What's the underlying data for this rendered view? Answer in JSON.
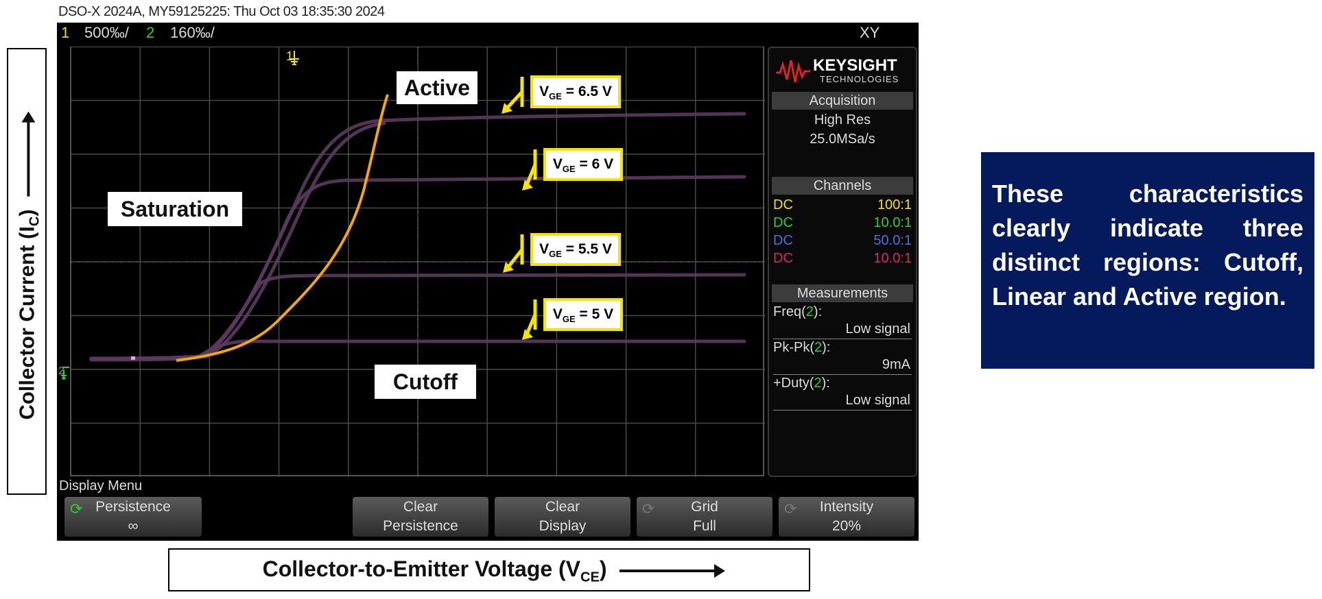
{
  "header": {
    "instrument_line": "DSO-X 2024A, MY59125225: Thu Oct 03 18:35:30 2024"
  },
  "topbar": {
    "ch1_num": "1",
    "ch1_scale": "500‰/",
    "ch2_num": "2",
    "ch2_scale": "160‰/",
    "mode": "XY",
    "colors": {
      "ch1": "#f5e400",
      "ch2": "#2fd12f"
    }
  },
  "plot": {
    "ch1_marker": "1",
    "ch2_marker": "2",
    "trace_color": "#5b3a5e",
    "boundary_color": "#f5a800"
  },
  "regions": {
    "active": "Active",
    "saturation": "Saturation",
    "cutoff": "Cutoff"
  },
  "vge_labels": [
    {
      "prefix": "V",
      "sub": "GE",
      "suffix": " = 6.5 V"
    },
    {
      "prefix": "V",
      "sub": "GE",
      "suffix": " = 6 V"
    },
    {
      "prefix": "V",
      "sub": "GE",
      "suffix": " = 5.5 V"
    },
    {
      "prefix": "V",
      "sub": "GE",
      "suffix": " = 5 V"
    }
  ],
  "panel": {
    "brand": "KEYSIGHT",
    "brand_sub": "TECHNOLOGIES",
    "acquisition": {
      "title": "Acquisition",
      "mode": "High Res",
      "rate": "25.0MSa/s"
    },
    "channels": {
      "title": "Channels",
      "rows": [
        {
          "coupling": "DC",
          "ratio": "100:1",
          "color": "#f5e400"
        },
        {
          "coupling": "DC",
          "ratio": "10.0:1",
          "color": "#2fd12f"
        },
        {
          "coupling": "DC",
          "ratio": "50.0:1",
          "color": "#4f6fe0"
        },
        {
          "coupling": "DC",
          "ratio": "10.0:1",
          "color": "#e0246a"
        }
      ]
    },
    "measurements": {
      "title": "Measurements",
      "items": [
        {
          "name": "Freq(",
          "ch": "2",
          "close": "):",
          "value": "Low signal"
        },
        {
          "name": "Pk-Pk(",
          "ch": "2",
          "close": "):",
          "value": "9mA"
        },
        {
          "name": "+Duty(",
          "ch": "2",
          "close": "):",
          "value": "Low signal"
        }
      ]
    }
  },
  "menu": {
    "title": "Display Menu",
    "softkeys": [
      {
        "line1": "Persistence",
        "line2": "∞"
      },
      {
        "line1": "Clear",
        "line2": "Persistence"
      },
      {
        "line1": "Clear",
        "line2": "Display"
      },
      {
        "line1": "Grid",
        "line2": "Full"
      },
      {
        "line1": "Intensity",
        "line2": "20%"
      }
    ]
  },
  "axes": {
    "y_label_main": "Collector Current (I",
    "y_label_sub": "C",
    "y_label_close": ")",
    "x_label_main": "Collector-to-Emitter Voltage (V",
    "x_label_sub": "CE",
    "x_label_close": ")"
  },
  "note": "These characteristics clearly indicate three distinct regions: Cutoff, Linear and Active region."
}
